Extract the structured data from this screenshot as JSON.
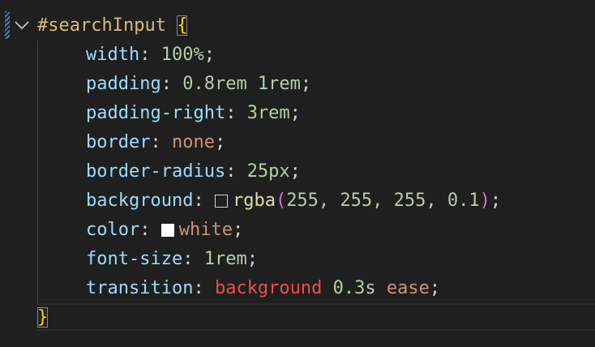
{
  "editor": {
    "selector": "#searchInput",
    "open_brace": "{",
    "close_brace": "}",
    "colors": {
      "background": "#1f1f1f",
      "selector": "#d7ba7d",
      "property": "#9cdcfe",
      "number": "#b5cea8",
      "keyword": "#ce9178",
      "function": "#dcdcaa",
      "brace": "#ffd700"
    },
    "lines": [
      {
        "prop": "width",
        "value": "100%"
      },
      {
        "prop": "padding",
        "value": "0.8rem 1rem"
      },
      {
        "prop": "padding-right",
        "value": "3rem"
      },
      {
        "prop": "border",
        "value": "none"
      },
      {
        "prop": "border-radius",
        "value": "25px"
      },
      {
        "prop": "background",
        "fn": "rgba",
        "args": "255, 255, 255, 0.1"
      },
      {
        "prop": "color",
        "value": "white"
      },
      {
        "prop": "font-size",
        "value": "1rem"
      },
      {
        "prop": "transition",
        "value_a": "background",
        "value_b": "0.3s",
        "value_c": "ease"
      }
    ],
    "colon": ":",
    "semicolon": ";"
  }
}
